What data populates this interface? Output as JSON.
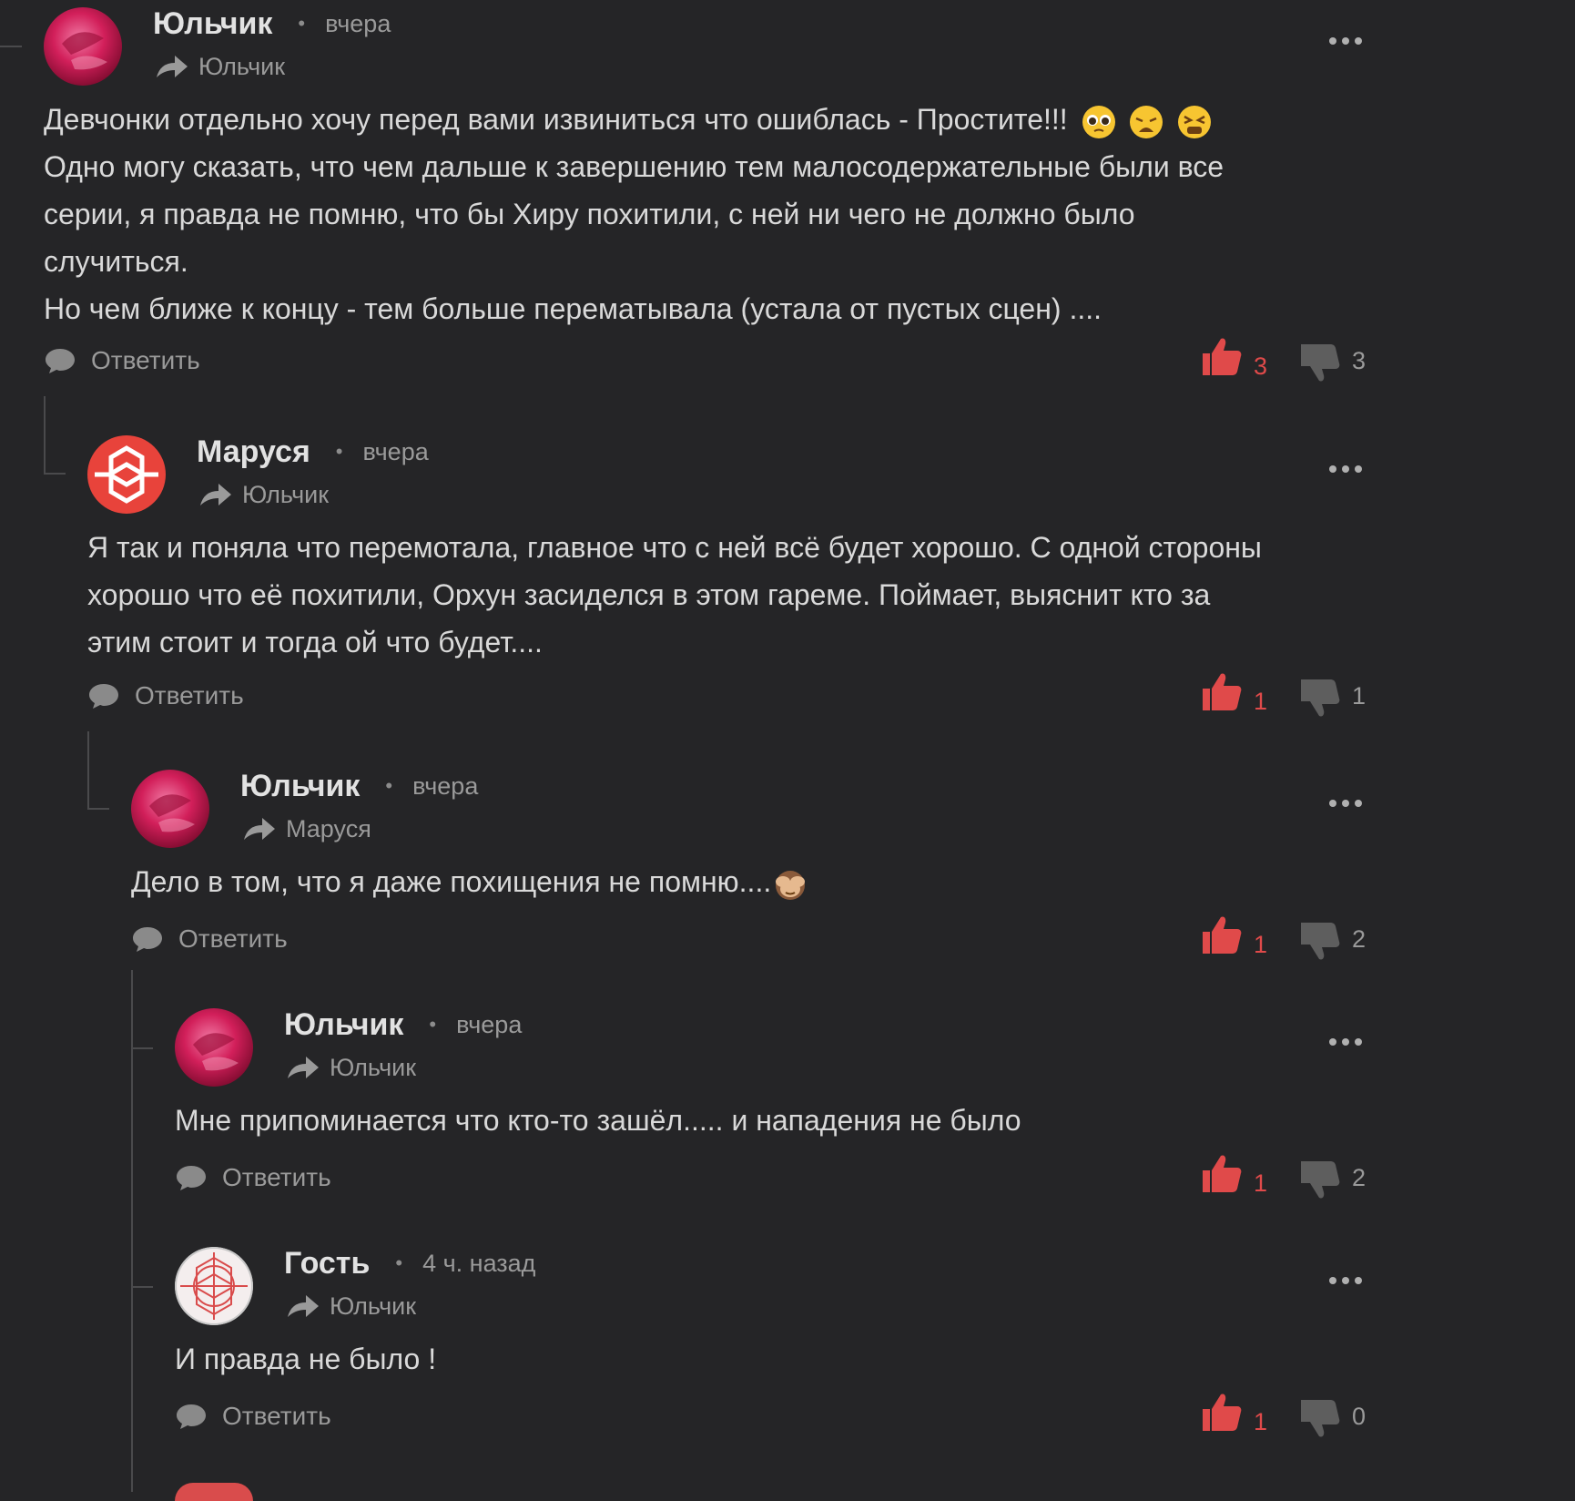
{
  "colors": {
    "background": "#252527",
    "like": "#e04a4a",
    "muted": "#9a9a9a",
    "text": "#d9d9d9"
  },
  "reply_label": "Ответить",
  "comments": [
    {
      "author": "Юльчик",
      "time": "вчера",
      "reply_to": "Юльчик",
      "avatar": "rose-avatar",
      "lines": [
        "Девчонки отдельно хочу перед вами извиниться что ошиблась - Простите!!!",
        "Одно могу сказать, что чем дальше к завершению тем малосодержательные были все",
        "серии, я правда не помню, что бы Хиру похитили, с ней ни чего не должно было",
        "случиться.",
        "Но чем ближе к концу - тем больше перематывала (устала от пустых сцен) ...."
      ],
      "emojis": [
        "pleading-face",
        "weary-face",
        "tired-face"
      ],
      "likes": "3",
      "dislikes": "3"
    },
    {
      "author": "Маруся",
      "time": "вчера",
      "reply_to": "Юльчик",
      "avatar": "red-pattern-avatar",
      "lines": [
        "Я так и поняла что перемотала, главное что с ней всё будет хорошо. С одной стороны",
        "хорошо что её похитили, Орхун засиделся в этом гареме. Поймает, выяснит кто за",
        "этим стоит и тогда ой что будет...."
      ],
      "likes": "1",
      "dislikes": "1"
    },
    {
      "author": "Юльчик",
      "time": "вчера",
      "reply_to": "Маруся",
      "avatar": "rose-avatar",
      "lines": [
        "Дело в том, что я даже похищения не помню...."
      ],
      "emojis": [
        "see-no-evil-monkey"
      ],
      "likes": "1",
      "dislikes": "2"
    },
    {
      "author": "Юльчик",
      "time": "вчера",
      "reply_to": "Юльчик",
      "avatar": "rose-avatar",
      "lines": [
        "Мне припоминается что кто-то зашёл..... и нападения не было"
      ],
      "likes": "1",
      "dislikes": "2"
    },
    {
      "author": "Гость",
      "time": "4 ч. назад",
      "reply_to": "Юльчик",
      "avatar": "guest-pattern-avatar",
      "lines": [
        "И правда не было !"
      ],
      "likes": "1",
      "dislikes": "0"
    }
  ]
}
